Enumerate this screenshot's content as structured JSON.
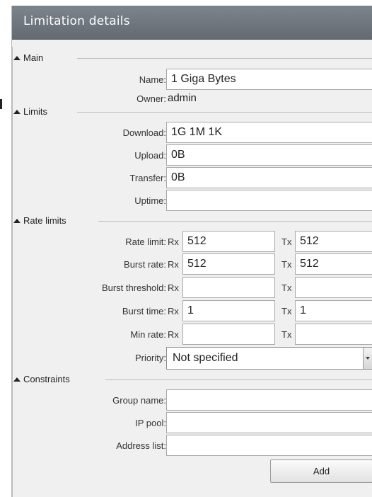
{
  "window": {
    "title": "Limitation details"
  },
  "sections": {
    "main": "Main",
    "limits": "Limits",
    "rate_limits": "Rate limits",
    "constraints": "Constraints"
  },
  "main": {
    "name_label": "Name:",
    "name_value": "1 Giga Bytes",
    "owner_label": "Owner:",
    "owner_value": "admin"
  },
  "limits": {
    "download_label": "Download:",
    "download_value": "1G 1M 1K",
    "upload_label": "Upload:",
    "upload_value": "0B",
    "transfer_label": "Transfer:",
    "transfer_value": "0B",
    "uptime_label": "Uptime:",
    "uptime_value": ""
  },
  "rate_limits": {
    "rx_prefix": "Rx",
    "tx_prefix": "Tx",
    "rate_limit_label": "Rate limit:",
    "rate_limit_rx": "512",
    "rate_limit_tx": "512",
    "burst_rate_label": "Burst rate:",
    "burst_rate_rx": "512",
    "burst_rate_tx": "512",
    "burst_threshold_label": "Burst threshold:",
    "burst_threshold_rx": "",
    "burst_threshold_tx": "",
    "burst_time_label": "Burst time:",
    "burst_time_rx": "1",
    "burst_time_tx": "1",
    "min_rate_label": "Min rate:",
    "min_rate_rx": "",
    "min_rate_tx": "",
    "priority_label": "Priority:",
    "priority_value": "Not specified"
  },
  "constraints": {
    "group_name_label": "Group name:",
    "group_name_value": "",
    "ip_pool_label": "IP pool:",
    "ip_pool_value": "",
    "address_list_label": "Address list:",
    "address_list_value": ""
  },
  "actions": {
    "add_label": "Add"
  }
}
